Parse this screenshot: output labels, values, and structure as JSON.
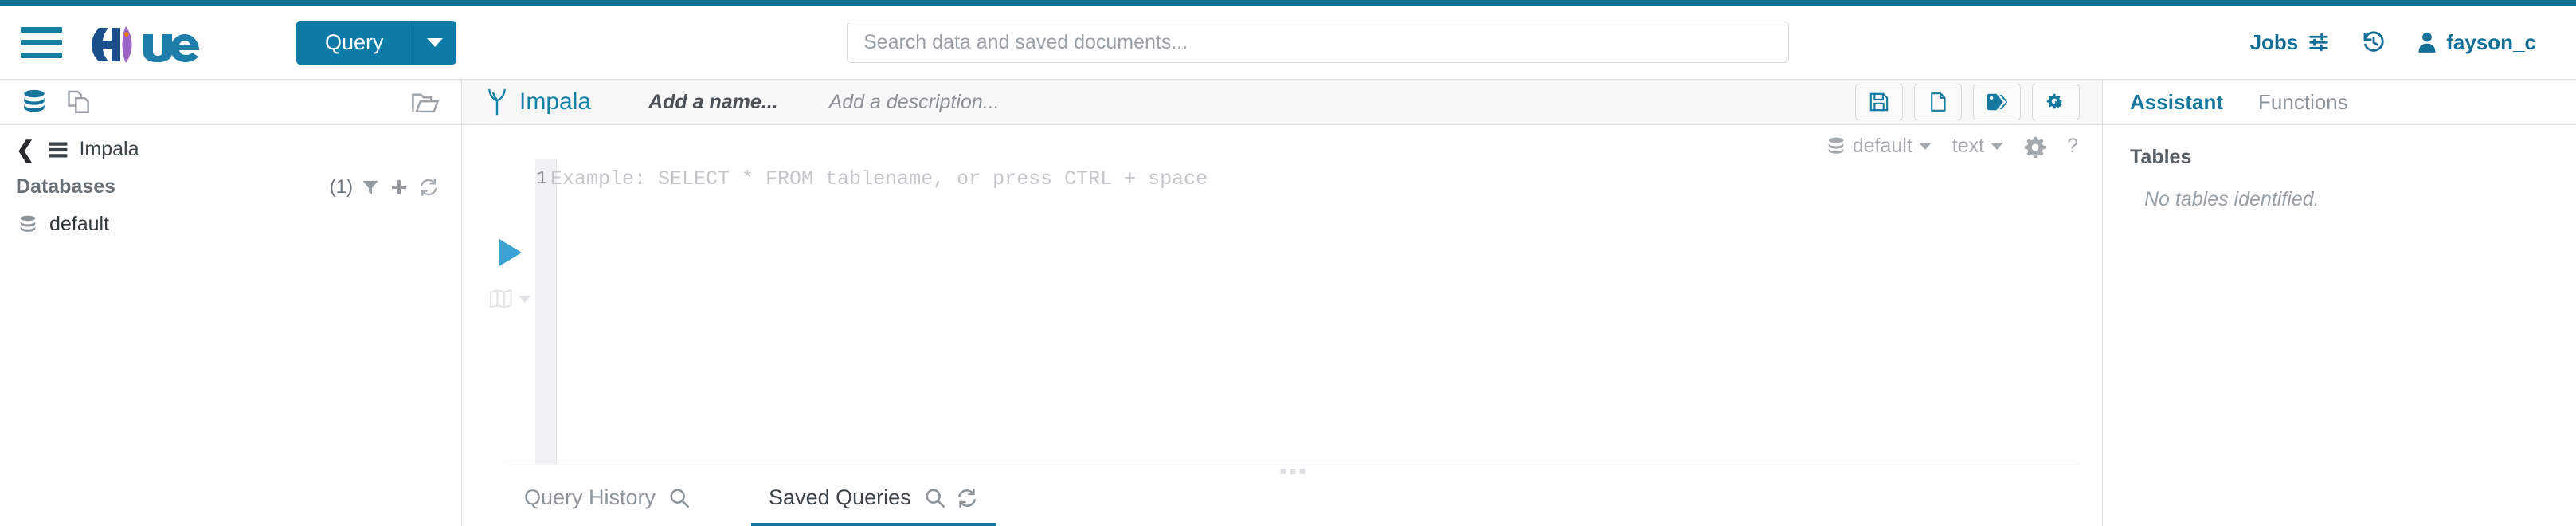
{
  "theme": {
    "brand_blue": "#0c7ba8",
    "accent_strip": "#0b7093",
    "link_blue": "#167fa5",
    "muted_gray": "#8d9499",
    "active_tab_underline": "#1476a0"
  },
  "header": {
    "menu_icon": "hamburger-icon",
    "logo_text": "Hue",
    "query_button": {
      "label": "Query",
      "caret_icon": "chevron-down-icon"
    },
    "search": {
      "value": "",
      "placeholder": "Search data and saved documents..."
    },
    "jobs": {
      "label": "Jobs",
      "icon": "sliders-icon"
    },
    "history": {
      "icon": "history-clock-icon"
    },
    "user": {
      "icon": "user-icon",
      "name": "fayson_c"
    }
  },
  "sidebar": {
    "top_icons": [
      {
        "name": "database-icon",
        "state": "active"
      },
      {
        "name": "documents-icon",
        "state": "inactive"
      },
      {
        "name": "open-folder-icon",
        "state": "inactive"
      }
    ],
    "breadcrumb": {
      "back_icon": "chevron-left-icon",
      "source_icon": "server-stack-icon",
      "source_label": "Impala"
    },
    "section": {
      "title": "Databases",
      "count": "(1)",
      "actions": [
        {
          "name": "filter-icon"
        },
        {
          "name": "plus-icon"
        },
        {
          "name": "refresh-icon"
        }
      ]
    },
    "databases": [
      {
        "icon": "database-icon",
        "label": "default"
      }
    ]
  },
  "editor": {
    "engine": {
      "icon": "impala-logo-icon",
      "label": "Impala"
    },
    "name_field": {
      "value": "",
      "placeholder": "Add a name..."
    },
    "description_field": {
      "value": "",
      "placeholder": "Add a description..."
    },
    "actions": [
      {
        "name": "save-button",
        "icon": "floppy-disk-icon"
      },
      {
        "name": "new-query-button",
        "icon": "file-icon"
      },
      {
        "name": "tag-button",
        "icon": "tag-icon"
      },
      {
        "name": "settings-button",
        "icon": "gears-icon"
      }
    ],
    "settings_bar": {
      "database": {
        "icon": "database-icon",
        "label": "default",
        "caret": "chevron-down-icon"
      },
      "result_format": {
        "label": "text",
        "caret": "chevron-down-icon"
      },
      "gear": {
        "icon": "gear-icon"
      },
      "help": {
        "label": "?"
      }
    },
    "code": {
      "line_number": "1",
      "placeholder": "Example: SELECT * FROM tablename, or press CTRL + space",
      "value": ""
    },
    "run_controls": [
      {
        "name": "execute-button",
        "icon": "play-icon"
      },
      {
        "name": "explain-button",
        "icon": "book-icon",
        "caret": "chevron-down-icon"
      }
    ],
    "drag_handle": "resize-handle",
    "bottom_tabs": [
      {
        "label": "Query History",
        "active": false,
        "icons": [
          {
            "name": "search-icon"
          }
        ]
      },
      {
        "label": "Saved Queries",
        "active": true,
        "icons": [
          {
            "name": "search-icon"
          },
          {
            "name": "refresh-icon"
          }
        ]
      }
    ]
  },
  "assistant": {
    "tabs": [
      {
        "label": "Assistant",
        "active": true
      },
      {
        "label": "Functions",
        "active": false
      }
    ],
    "tables_heading": "Tables",
    "tables_empty": "No tables identified."
  }
}
